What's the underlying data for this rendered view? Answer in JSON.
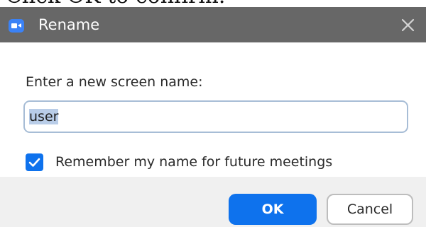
{
  "background_caption": "Click OK to confirm.",
  "dialog": {
    "title": "Rename",
    "app_icon": "zoom-video-camera-icon",
    "close_icon": "close-icon",
    "prompt_label": "Enter a new screen name:",
    "name_input": {
      "value": "user",
      "selected": true
    },
    "remember_checkbox": {
      "checked": true,
      "label": "Remember my name for future meetings"
    },
    "buttons": {
      "ok_label": "OK",
      "cancel_label": "Cancel"
    }
  },
  "colors": {
    "titlebar": "#676767",
    "accent": "#0e72ed",
    "footer": "#f0f0f0",
    "input_border": "#a7bdd6"
  }
}
